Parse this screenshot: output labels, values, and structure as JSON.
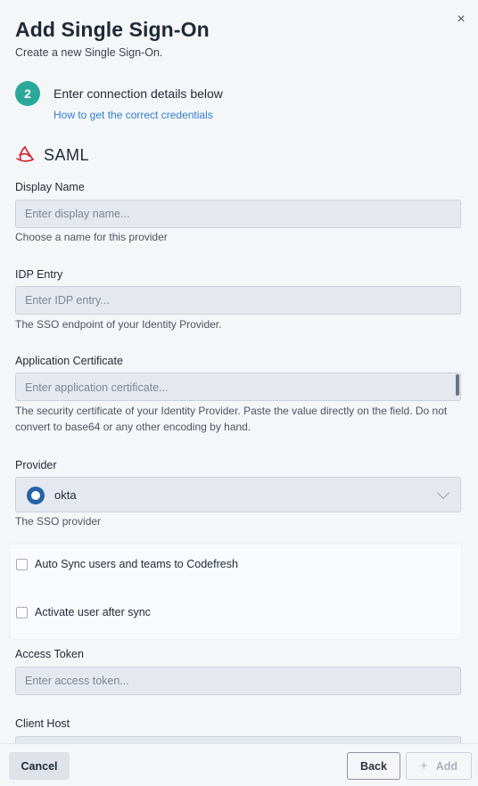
{
  "dialog": {
    "close_glyph": "×",
    "title": "Add Single Sign-On",
    "subtitle": "Create a new Single Sign-On."
  },
  "step": {
    "number": "2",
    "text": "Enter connection details below",
    "link": "How to get the correct credentials"
  },
  "provider_type": {
    "icon": "saml-icon",
    "label": "SAML"
  },
  "fields": {
    "display_name": {
      "label": "Display Name",
      "placeholder": "Enter display name...",
      "value": "",
      "hint": "Choose a name for this provider"
    },
    "idp_entry": {
      "label": "IDP Entry",
      "placeholder": "Enter IDP entry...",
      "value": "",
      "hint": "The SSO endpoint of your Identity Provider."
    },
    "application_certificate": {
      "label": "Application Certificate",
      "placeholder": "Enter application certificate...",
      "value": "",
      "hint": "The security certificate of your Identity Provider. Paste the value directly on the field. Do not convert to base64 or any other encoding by hand."
    },
    "provider": {
      "label": "Provider",
      "selected": "okta",
      "icon": "okta-icon",
      "hint": "The SSO provider"
    },
    "access_token": {
      "label": "Access Token",
      "placeholder": "Enter access token...",
      "value": ""
    },
    "client_host": {
      "label": "Client Host"
    }
  },
  "sync_options": {
    "auto_sync": {
      "label": "Auto Sync users and teams to Codefresh",
      "checked": false
    },
    "activate_user": {
      "label": "Activate user after sync",
      "checked": false
    }
  },
  "footer": {
    "cancel_label": "Cancel",
    "back_label": "Back",
    "add_label": "Add",
    "add_glyph": "+"
  },
  "colors": {
    "accent_step": "#2aa99b",
    "link": "#2f7fd1",
    "saml_brand": "#d0202a",
    "okta_brand": "#2563a8"
  }
}
